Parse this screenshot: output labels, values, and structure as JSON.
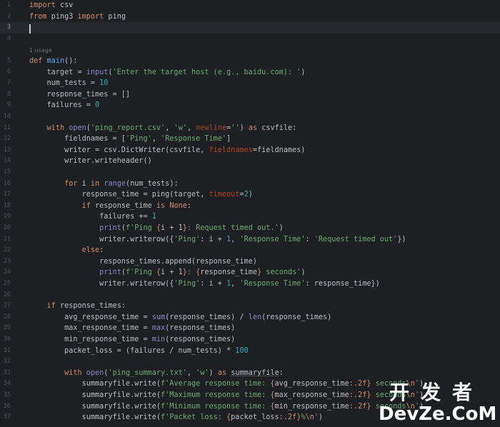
{
  "editor": {
    "usage_hint": "1 usage",
    "lines": [
      {
        "n": "1",
        "t": "import csv"
      },
      {
        "n": "2",
        "t": "from ping3 import ping"
      },
      {
        "n": "3",
        "t": ""
      },
      {
        "n": "4",
        "t": ""
      },
      {
        "n": "5",
        "t": "def main():"
      },
      {
        "n": "6",
        "t": "    target = input('Enter the target host (e.g., baidu.com): ')"
      },
      {
        "n": "7",
        "t": "    num_tests = 10"
      },
      {
        "n": "8",
        "t": "    response_times = []"
      },
      {
        "n": "9",
        "t": "    failures = 0"
      },
      {
        "n": "10",
        "t": ""
      },
      {
        "n": "11",
        "t": "    with open('ping_report.csv', 'w', newline='') as csvfile:"
      },
      {
        "n": "12",
        "t": "        fieldnames = ['Ping', 'Response Time']"
      },
      {
        "n": "13",
        "t": "        writer = csv.DictWriter(csvfile, fieldnames=fieldnames)"
      },
      {
        "n": "14",
        "t": "        writer.writeheader()"
      },
      {
        "n": "15",
        "t": ""
      },
      {
        "n": "16",
        "t": "        for i in range(num_tests):"
      },
      {
        "n": "17",
        "t": "            response_time = ping(target, timeout=2)"
      },
      {
        "n": "18",
        "t": "            if response_time is None:"
      },
      {
        "n": "19",
        "t": "                failures += 1"
      },
      {
        "n": "20",
        "t": "                print(f'Ping {i + 1}: Request timed out.')"
      },
      {
        "n": "21",
        "t": "                writer.writerow({'Ping': i + 1, 'Response Time': 'Request timed out'})"
      },
      {
        "n": "22",
        "t": "            else:"
      },
      {
        "n": "23",
        "t": "                response_times.append(response_time)"
      },
      {
        "n": "24",
        "t": "                print(f'Ping {i + 1}: {response_time} seconds')"
      },
      {
        "n": "25",
        "t": "                writer.writerow({'Ping': i + 1, 'Response Time': response_time})"
      },
      {
        "n": "26",
        "t": ""
      },
      {
        "n": "27",
        "t": "    if response_times:"
      },
      {
        "n": "28",
        "t": "        avg_response_time = sum(response_times) / len(response_times)"
      },
      {
        "n": "29",
        "t": "        max_response_time = max(response_times)"
      },
      {
        "n": "30",
        "t": "        min_response_time = min(response_times)"
      },
      {
        "n": "31",
        "t": "        packet_loss = (failures / num_tests) * 100"
      },
      {
        "n": "32",
        "t": ""
      },
      {
        "n": "33",
        "t": "        with open('ping_summary.txt', 'w') as summaryfile:"
      },
      {
        "n": "34",
        "t": "            summaryfile.write(f'Average response time: {avg_response_time:.2f} seconds\\n')"
      },
      {
        "n": "35",
        "t": "            summaryfile.write(f'Maximum response time: {max_response_time:.2f} seconds\\n')"
      },
      {
        "n": "36",
        "t": "            summaryfile.write(f'Minimum response time: {min_response_time:.2f} seconds\\n')"
      },
      {
        "n": "37",
        "t": "            summaryfile.write(f'Packet loss: {packet_loss:.2f}%\\n')"
      }
    ]
  },
  "watermark": {
    "top": "开发者",
    "bottom": "DevZe.CoM"
  },
  "colors": {
    "background": "#1e1f22",
    "keyword": "#cf8e6d",
    "string": "#6aab73",
    "number": "#2aacb8",
    "function": "#56a8f5",
    "builtin": "#8888c6",
    "parameter": "#aa4926"
  }
}
